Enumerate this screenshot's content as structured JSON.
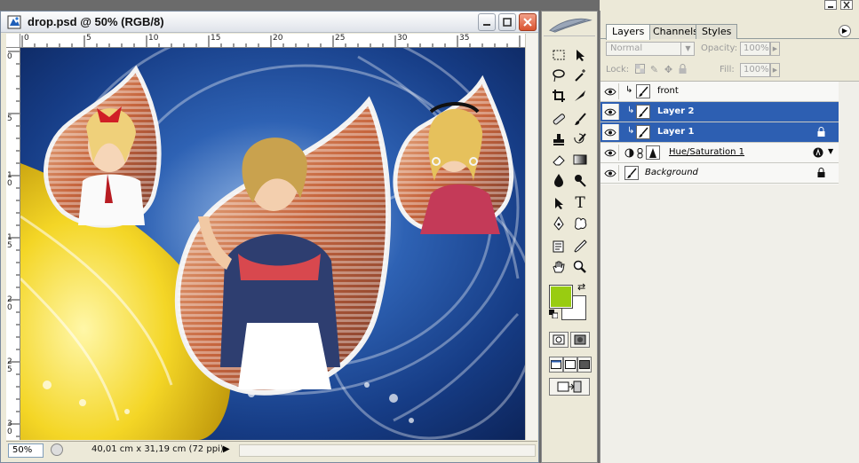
{
  "document": {
    "title": "drop.psd @ 50% (RGB/8)",
    "zoom": "50%",
    "doc_size": "40,01 cm x 31,19 cm (72 ppi)",
    "ruler_h": [
      "0",
      "5",
      "10",
      "15",
      "20",
      "25",
      "30",
      "35"
    ],
    "ruler_v": [
      "0",
      "5",
      "1\n0",
      "1\n5",
      "2\n0",
      "2\n5",
      "3\n0"
    ],
    "canvas_description_colors": {
      "water": "#1d4b9a",
      "lemon": "#f2d21c"
    }
  },
  "toolbox": {
    "foreground_color": "#99cc11",
    "background_color": "#ffffff",
    "tools": [
      "marquee-tool",
      "move-tool",
      "lasso-tool",
      "magic-wand-tool",
      "crop-tool",
      "slice-tool",
      "healing-brush-tool",
      "brush-tool",
      "clone-stamp-tool",
      "history-brush-tool",
      "eraser-tool",
      "gradient-tool",
      "blur-tool",
      "dodge-tool",
      "path-selection-tool",
      "type-tool",
      "pen-tool",
      "shape-tool",
      "notes-tool",
      "eyedropper-tool",
      "hand-tool",
      "zoom-tool"
    ]
  },
  "layers_panel": {
    "tabs": [
      "Layers",
      "Channels",
      "Styles"
    ],
    "active_tab": "Layers",
    "blend_mode": "Normal",
    "opacity_label": "Opacity:",
    "opacity_value": "100%",
    "lock_label": "Lock:",
    "fill_label": "Fill:",
    "fill_value": "100%",
    "layers": [
      {
        "name": "front",
        "selected": false,
        "clipped": true,
        "locked": false,
        "type": "pixel"
      },
      {
        "name": "Layer 2",
        "selected": true,
        "clipped": true,
        "locked": false,
        "type": "pixel"
      },
      {
        "name": "Layer 1",
        "selected": true,
        "clipped": true,
        "locked": true,
        "type": "pixel"
      },
      {
        "name": "Hue/Saturation 1",
        "selected": false,
        "clipped": false,
        "locked": false,
        "type": "adjustment"
      },
      {
        "name": "Background",
        "selected": false,
        "clipped": false,
        "locked": true,
        "type": "background"
      }
    ],
    "selection_color": "#2d5fb2"
  }
}
